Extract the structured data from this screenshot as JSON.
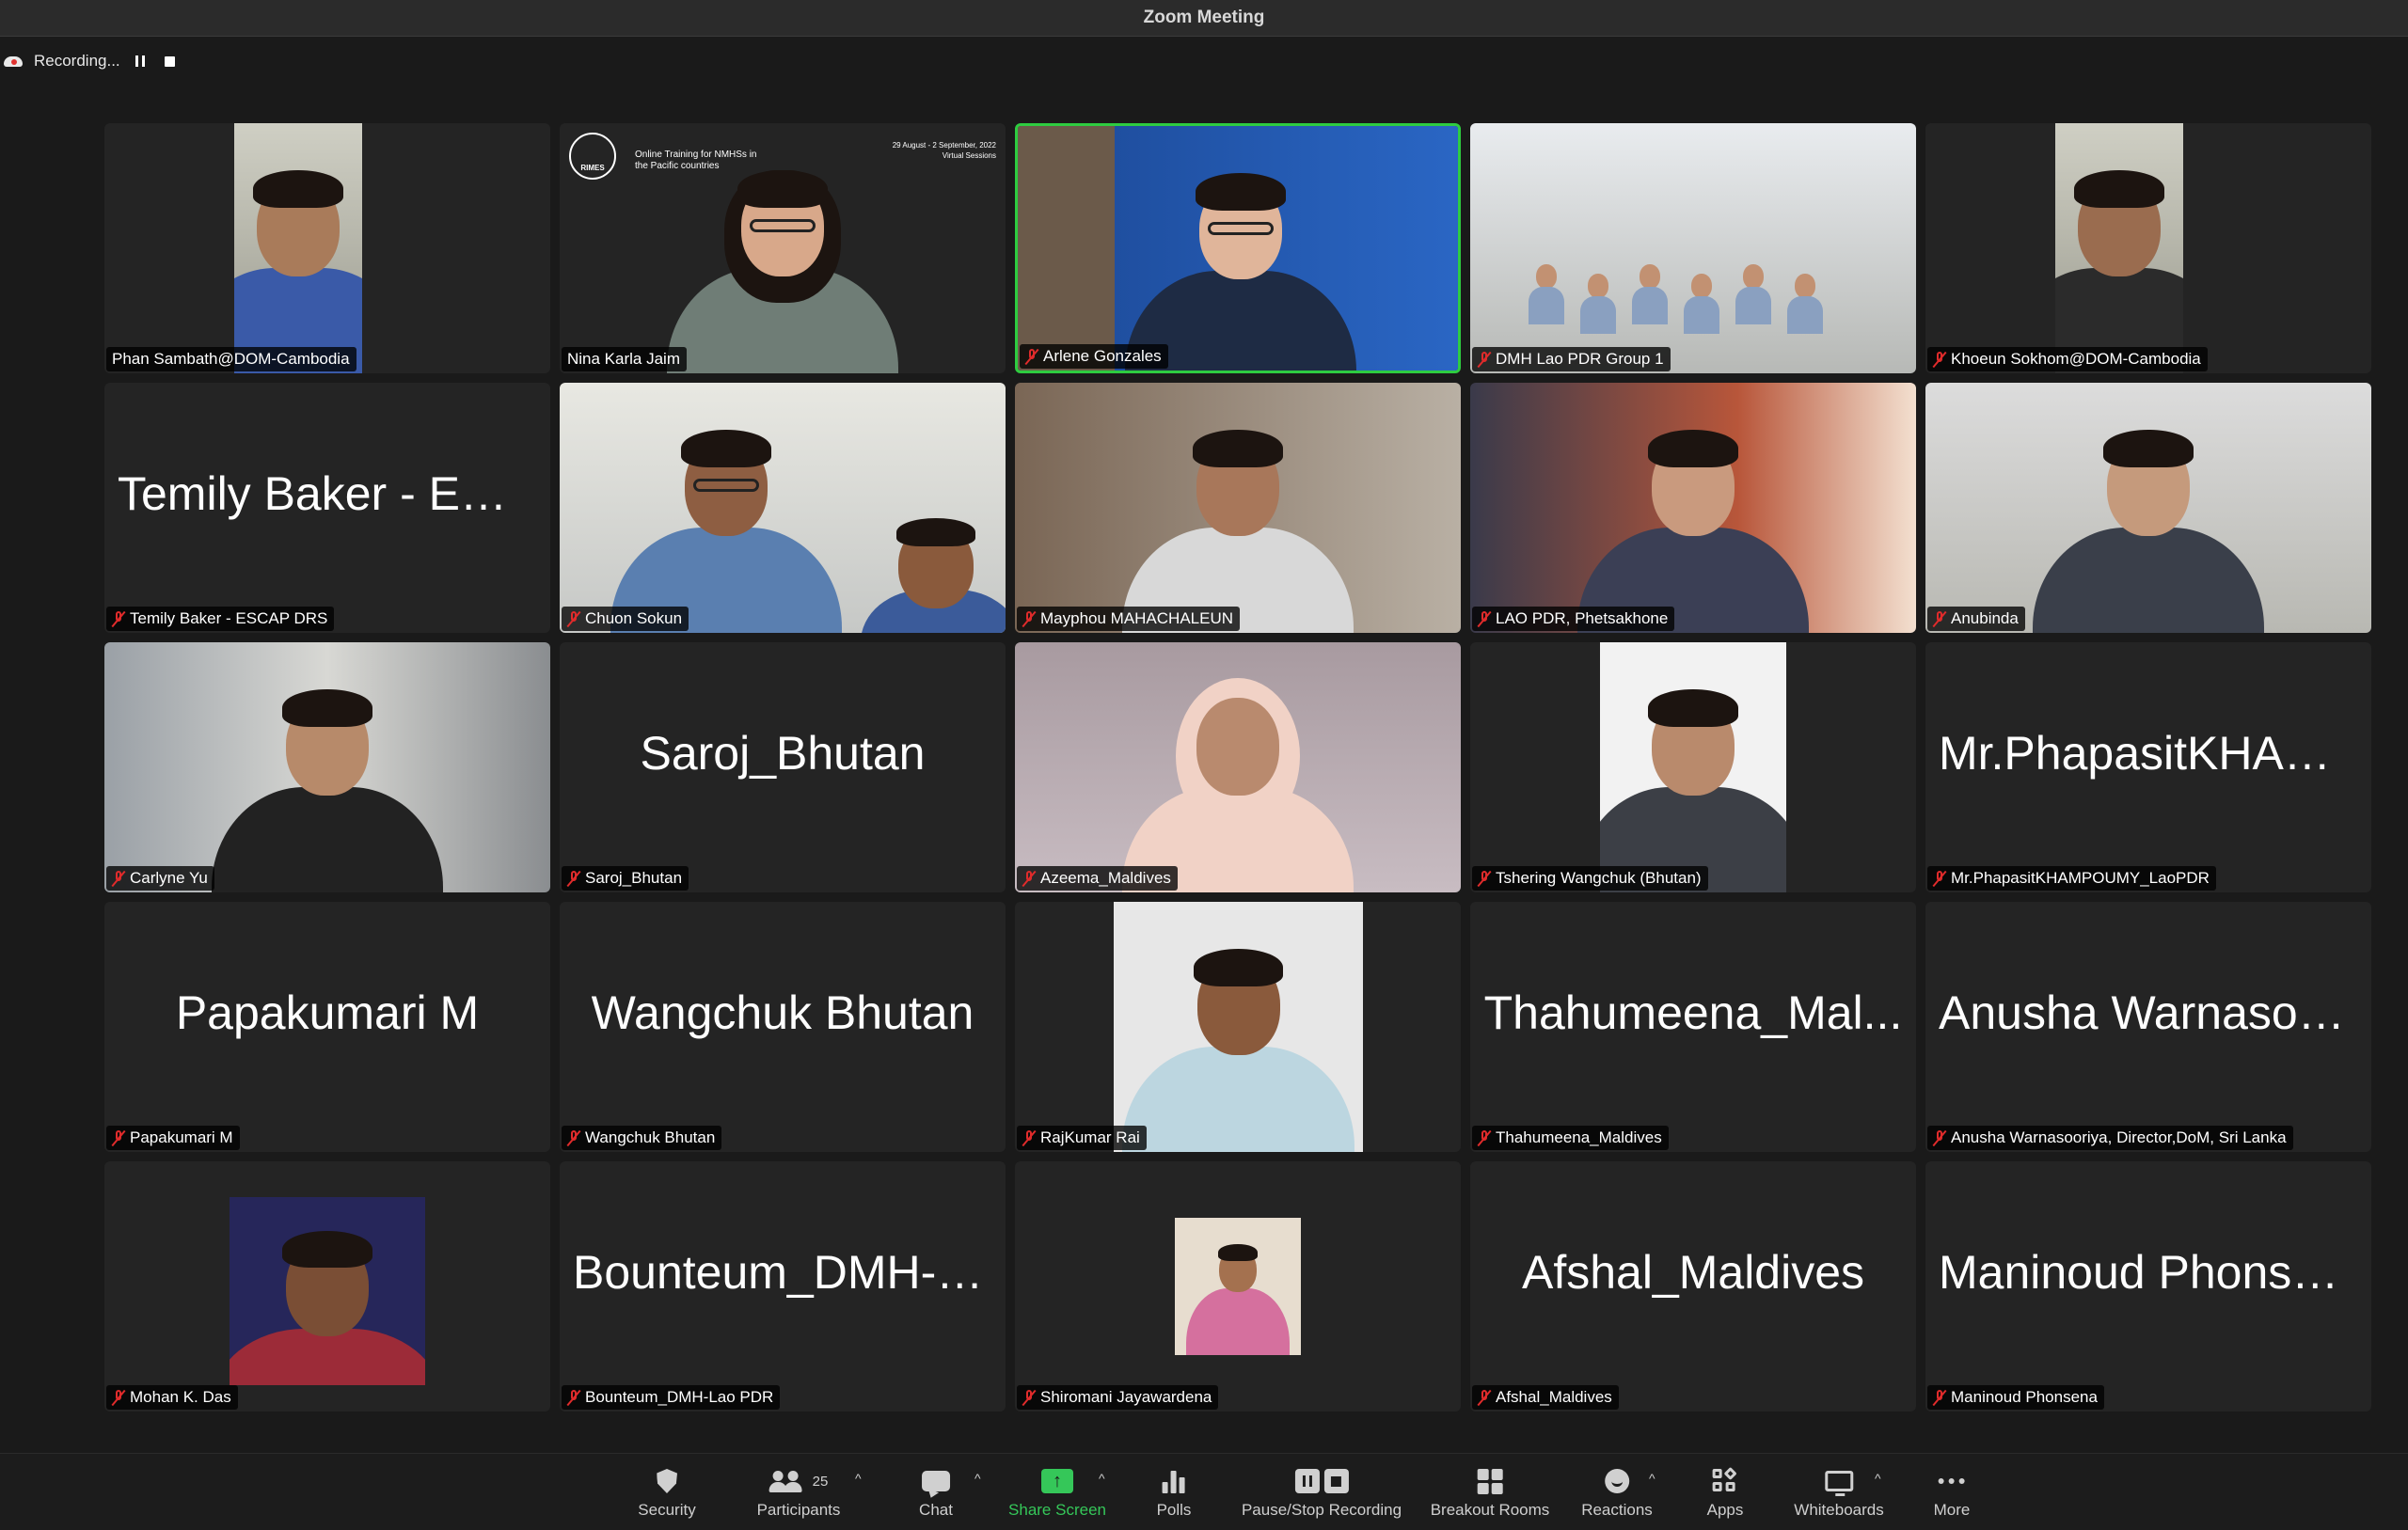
{
  "window": {
    "title": "Zoom Meeting"
  },
  "recording": {
    "label": "Recording...",
    "pause_icon": "pause-icon",
    "stop_icon": "stop-icon",
    "accent": "#e0322f"
  },
  "participants": [
    {
      "display_name": "Phan Sambath@DOM-Cambodia",
      "big_name": "",
      "muted": false,
      "video": true,
      "active": false
    },
    {
      "display_name": "Nina Karla Jaim",
      "big_name": "",
      "muted": false,
      "video": true,
      "active": false,
      "background_text": {
        "heading": "Online Training for NMHSs in the Pacific countries",
        "dates": "29 August - 2 September, 2022",
        "subtitle": "Virtual Sessions",
        "logo": "RIMES"
      }
    },
    {
      "display_name": "Arlene Gonzales",
      "big_name": "",
      "muted": true,
      "video": true,
      "active": true
    },
    {
      "display_name": "DMH Lao PDR Group 1",
      "big_name": "",
      "muted": true,
      "video": true,
      "active": false
    },
    {
      "display_name": "Khoeun Sokhom@DOM-Cambodia",
      "big_name": "",
      "muted": true,
      "video": true,
      "active": false
    },
    {
      "display_name": "Temily Baker - ESCAP DRS",
      "big_name": "Temily Baker - ESC...",
      "muted": true,
      "video": false,
      "active": false
    },
    {
      "display_name": "Chuon Sokun",
      "big_name": "",
      "muted": true,
      "video": true,
      "active": false
    },
    {
      "display_name": "Mayphou MAHACHALEUN",
      "big_name": "",
      "muted": true,
      "video": true,
      "active": false
    },
    {
      "display_name": "LAO PDR, Phetsakhone",
      "big_name": "",
      "muted": true,
      "video": true,
      "active": false
    },
    {
      "display_name": "Anubinda",
      "big_name": "",
      "muted": true,
      "video": true,
      "active": false
    },
    {
      "display_name": "Carlyne Yu",
      "big_name": "",
      "muted": true,
      "video": true,
      "active": false
    },
    {
      "display_name": "Saroj_Bhutan",
      "big_name": "Saroj_Bhutan",
      "muted": true,
      "video": false,
      "active": false
    },
    {
      "display_name": "Azeema_Maldives",
      "big_name": "",
      "muted": true,
      "video": true,
      "active": false
    },
    {
      "display_name": "Tshering Wangchuk (Bhutan)",
      "big_name": "",
      "muted": true,
      "video": true,
      "active": false
    },
    {
      "display_name": "Mr.PhapasitKHAMPOUMY_LaoPDR",
      "big_name": "Mr.PhapasitKHAM...",
      "muted": true,
      "video": false,
      "active": false
    },
    {
      "display_name": "Papakumari M",
      "big_name": "Papakumari M",
      "muted": true,
      "video": false,
      "active": false
    },
    {
      "display_name": "Wangchuk  Bhutan",
      "big_name": "Wangchuk  Bhutan",
      "muted": true,
      "video": false,
      "active": false
    },
    {
      "display_name": "RajKumar Rai",
      "big_name": "",
      "muted": true,
      "video": true,
      "active": false
    },
    {
      "display_name": "Thahumeena_Maldives",
      "big_name": "Thahumeena_Mal...",
      "muted": true,
      "video": false,
      "active": false
    },
    {
      "display_name": "Anusha Warnasooriya, Director,DoM, Sri Lanka",
      "big_name": "Anusha Warnasoor...",
      "muted": true,
      "video": false,
      "active": false
    },
    {
      "display_name": "Mohan K. Das",
      "big_name": "",
      "muted": true,
      "video": true,
      "active": false
    },
    {
      "display_name": "Bounteum_DMH-Lao PDR",
      "big_name": "Bounteum_DMH-L...",
      "muted": true,
      "video": false,
      "active": false
    },
    {
      "display_name": "Shiromani Jayawardena",
      "big_name": "",
      "muted": true,
      "video": true,
      "active": false
    },
    {
      "display_name": "Afshal_Maldives",
      "big_name": "Afshal_Maldives",
      "muted": true,
      "video": false,
      "active": false
    },
    {
      "display_name": "Maninoud Phonsena",
      "big_name": "Maninoud Phonsena",
      "muted": true,
      "video": false,
      "active": false
    }
  ],
  "toolbar": {
    "security": "Security",
    "participants": "Participants",
    "participants_count": "25",
    "chat": "Chat",
    "share_screen": "Share Screen",
    "polls": "Polls",
    "pause_stop_recording": "Pause/Stop Recording",
    "breakout_rooms": "Breakout Rooms",
    "reactions": "Reactions",
    "apps": "Apps",
    "whiteboards": "Whiteboards",
    "more": "More"
  },
  "colors": {
    "active_speaker": "#2ecc40",
    "share_green": "#35c759",
    "muted_red": "#e02b2b",
    "tile_bg": "#242424"
  }
}
